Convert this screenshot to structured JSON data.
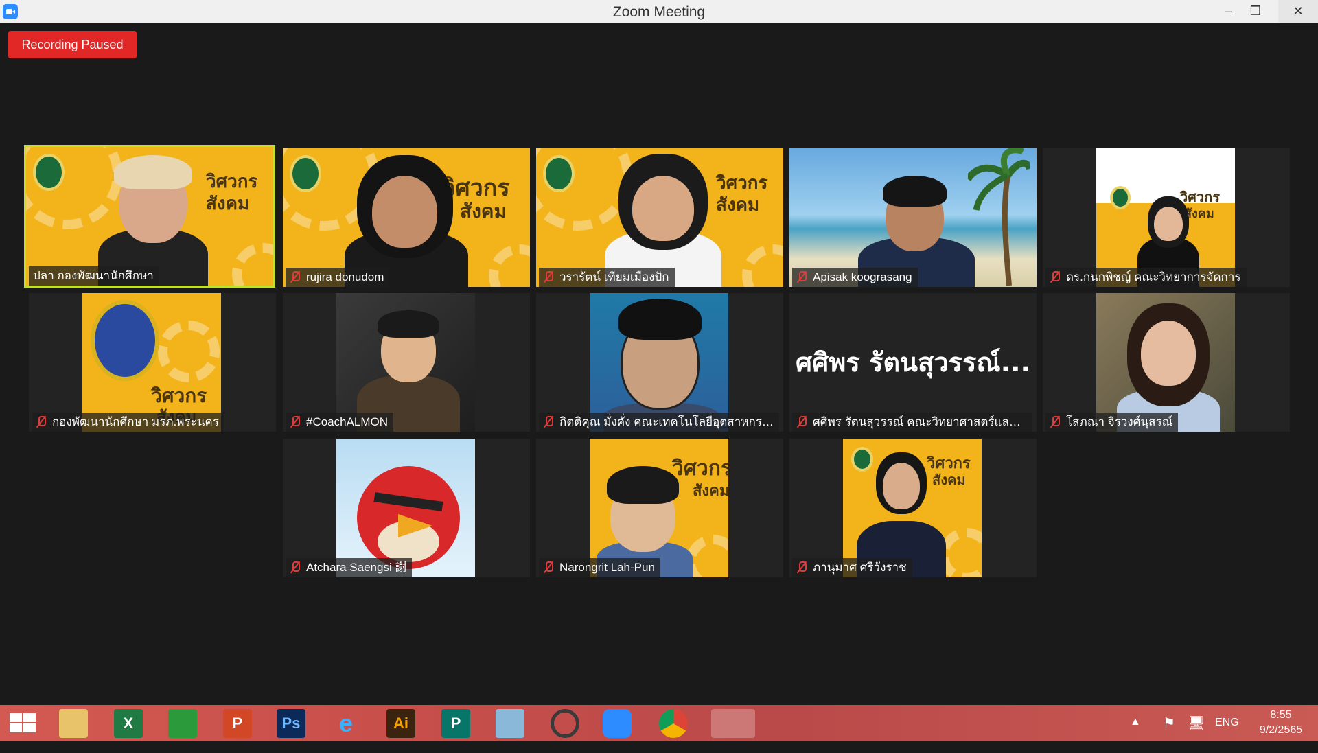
{
  "window": {
    "title": "Zoom Meeting",
    "minimize_icon": "minimize-icon",
    "restore_icon": "restore-icon",
    "close_icon": "close-icon"
  },
  "recording": {
    "label": "Recording Paused"
  },
  "participants": [
    {
      "name": "ปลา กองพัฒนานักศึกษา",
      "muted": false,
      "active_speaker": true,
      "background": "banner-yellow"
    },
    {
      "name": "rujira donudom",
      "muted": true,
      "background": "banner-yellow"
    },
    {
      "name": "วรารัตน์ เทียมเมืองปัก",
      "muted": true,
      "background": "banner-yellow"
    },
    {
      "name": "Apisak koograsang",
      "muted": true,
      "background": "beach"
    },
    {
      "name": "ดร.กนกพิชญ์ คณะวิทยาการจัดการ",
      "muted": true,
      "background": "banner-yellow"
    },
    {
      "name": "กองพัฒนานักศึกษา มรภ.พระนคร",
      "muted": true,
      "background": "logo"
    },
    {
      "name": "#CoachALMON",
      "muted": true,
      "background": "photo"
    },
    {
      "name": "กิตติคุณ มั่งคั่ง คณะเทคโนโลยีอุตสาหกรรม",
      "muted": true,
      "background": "cartoon"
    },
    {
      "name": "ศศิพร รัตนสุวรรณ์ คณะวิทยาศาสตร์และเทคโน...",
      "muted": true,
      "background": "name-only",
      "display_name": "ศศิพร รัตนสุวรรณ์..."
    },
    {
      "name": "โสภณา จิรวงศ์นุสรณ์",
      "muted": true,
      "background": "photo"
    },
    {
      "name": "Atchara Saengsi 謝",
      "muted": true,
      "background": "angry-bird"
    },
    {
      "name": "Narongrit Lah-Pun",
      "muted": true,
      "background": "cartoon-yellow"
    },
    {
      "name": "ภานุมาศ ศรีวังราช",
      "muted": true,
      "background": "banner-yellow"
    }
  ],
  "banner": {
    "line1": "วิศวกร",
    "line2": "สังคม"
  },
  "taskbar": {
    "apps": [
      {
        "icon": "file-explorer-icon",
        "label": ""
      },
      {
        "icon": "excel-icon",
        "label": "X"
      },
      {
        "icon": "store-icon",
        "label": ""
      },
      {
        "icon": "powerpoint-icon",
        "label": "P"
      },
      {
        "icon": "photoshop-icon",
        "label": "Ps"
      },
      {
        "icon": "internet-explorer-icon",
        "label": "e"
      },
      {
        "icon": "illustrator-icon",
        "label": "Ai"
      },
      {
        "icon": "publisher-icon",
        "label": "P"
      },
      {
        "icon": "paint-icon",
        "label": ""
      },
      {
        "icon": "photoscape-icon",
        "label": ""
      },
      {
        "icon": "zoom-icon",
        "label": ""
      },
      {
        "icon": "chrome-icon",
        "label": ""
      },
      {
        "icon": "office-icon",
        "label": ""
      }
    ],
    "language": "ENG",
    "time": "8:55",
    "date": "9/2/2565"
  },
  "colors": {
    "accent_recording": "#e22727",
    "active_speaker_border": "#c4dd33",
    "banner_yellow": "#f3b31a"
  }
}
